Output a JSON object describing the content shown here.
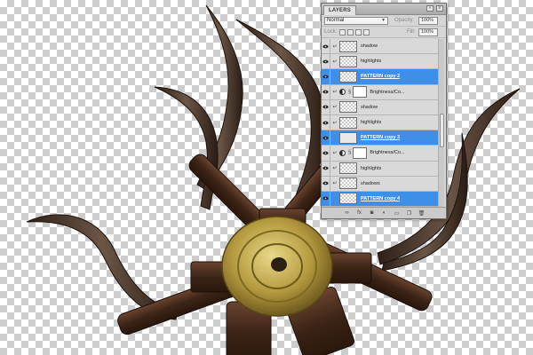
{
  "panel": {
    "tab_label": "LAYERS",
    "blend_mode": "Normal",
    "opacity_label": "Opacity:",
    "opacity_value": "100%",
    "lock_label": "Lock:",
    "fill_label": "Fill:",
    "fill_value": "100%",
    "layers": [
      {
        "name": "shadow",
        "type": "pixel",
        "clipped": true,
        "selected": false
      },
      {
        "name": "highlights",
        "type": "pixel",
        "clipped": true,
        "selected": false
      },
      {
        "name": "PATTERN copy 2",
        "type": "pixel",
        "clipped": false,
        "selected": true
      },
      {
        "name": "Brightness/Co...",
        "type": "adjustment",
        "clipped": true,
        "selected": false
      },
      {
        "name": "shadow",
        "type": "pixel",
        "clipped": true,
        "selected": false
      },
      {
        "name": "highlights",
        "type": "pixel",
        "clipped": true,
        "selected": false
      },
      {
        "name": "PATTERN copy 3",
        "type": "pattern",
        "clipped": false,
        "selected": true
      },
      {
        "name": "Brightness/Co...",
        "type": "adjustment",
        "clipped": true,
        "selected": false
      },
      {
        "name": "highlights",
        "type": "pixel",
        "clipped": true,
        "selected": false
      },
      {
        "name": "shadows",
        "type": "pixel",
        "clipped": true,
        "selected": false
      },
      {
        "name": "PATTERN copy 4",
        "type": "pixel",
        "clipped": false,
        "selected": true
      }
    ],
    "footer_icons": [
      "link-icon",
      "fx-icon",
      "mask-icon",
      "adjustment-icon",
      "folder-icon",
      "new-layer-icon",
      "trash-icon"
    ]
  },
  "colors": {
    "selected_row": "#3d8fe8",
    "horn_dark": "#3a2a20",
    "horn_light": "#6a5444",
    "wood": "#4a2e1c",
    "brass": "#b8a24a"
  }
}
